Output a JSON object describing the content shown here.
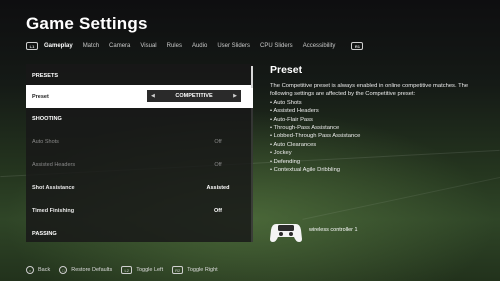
{
  "header": {
    "title": "Game Settings",
    "left_bumper": "L1",
    "right_bumper": "R1",
    "tabs": [
      {
        "label": "Gameplay",
        "active": true
      },
      {
        "label": "Match"
      },
      {
        "label": "Camera"
      },
      {
        "label": "Visual"
      },
      {
        "label": "Rules"
      },
      {
        "label": "Audio"
      },
      {
        "label": "User Sliders"
      },
      {
        "label": "CPU Sliders"
      },
      {
        "label": "Accessibility"
      }
    ]
  },
  "settings": {
    "rows": [
      {
        "type": "section",
        "label": "PRESETS"
      },
      {
        "type": "selected",
        "label": "Preset",
        "value": "COMPETITIVE"
      },
      {
        "type": "section",
        "label": "SHOOTING"
      },
      {
        "type": "disabled",
        "label": "Auto Shots",
        "value": "Off"
      },
      {
        "type": "disabled",
        "label": "Assisted Headers",
        "value": "Off"
      },
      {
        "type": "bold",
        "label": "Shot Assistance",
        "value": "Assisted"
      },
      {
        "type": "bold",
        "label": "Timed Finishing",
        "value": "Off"
      },
      {
        "type": "section",
        "label": "PASSING"
      }
    ]
  },
  "info_panel": {
    "title": "Preset",
    "description": "The Competitive preset is always enabled in online competitive matches. The following settings are affected by the Competitive preset:",
    "items": [
      "Auto Shots",
      "Assisted Headers",
      "Auto-Flair Pass",
      "Through-Pass Assistance",
      "Lobbed-Through Pass Assistance",
      "Auto Clearances",
      "Jockey",
      "Defending",
      "Contextual Agile Dribbling"
    ],
    "controller_label": "wireless controller 1"
  },
  "footer": {
    "hints": [
      {
        "icon": "circle-button-icon",
        "glyph": "○",
        "label": "Back"
      },
      {
        "icon": "square-button-icon",
        "glyph": "□",
        "label": "Restore Defaults"
      },
      {
        "icon": "l2-button-icon",
        "glyph": "L2",
        "label": "Toggle Left"
      },
      {
        "icon": "r2-button-icon",
        "glyph": "R2",
        "label": "Toggle Right"
      }
    ]
  }
}
